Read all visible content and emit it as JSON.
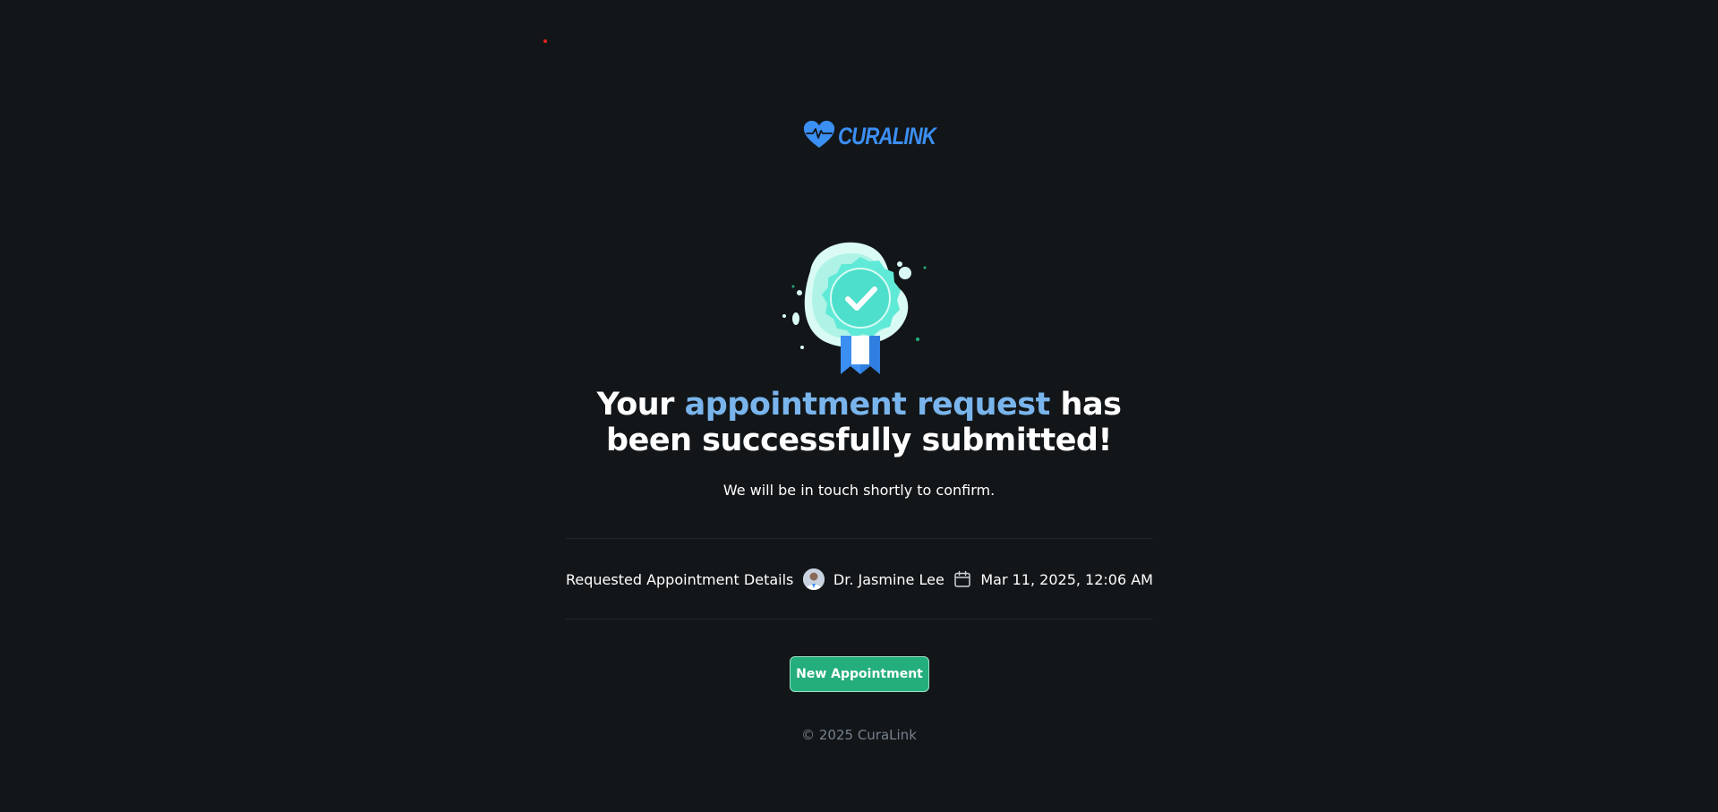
{
  "brand": {
    "name": "CURALINK",
    "accent_color": "#3b8ff3"
  },
  "success": {
    "headline_prefix": "Your ",
    "headline_accent": "appointment request",
    "headline_suffix": " has",
    "headline_line2": "been successfully submitted!",
    "subtitle": "We will be in touch shortly to confirm.",
    "accent_color": "#79b5ec"
  },
  "details": {
    "label": "Requested Appointment Details",
    "doctor": "Dr. Jasmine Lee",
    "datetime": "Mar 11, 2025, 12:06 AM"
  },
  "actions": {
    "new_appointment_label": "New Appointment",
    "button_color": "#24ae7c"
  },
  "footer": {
    "copyright": "© 2025 CuraLink"
  },
  "icons": {
    "logo": "heart-pulse-icon",
    "badge": "check-badge-icon",
    "doctor": "avatar",
    "calendar": "calendar-icon"
  }
}
